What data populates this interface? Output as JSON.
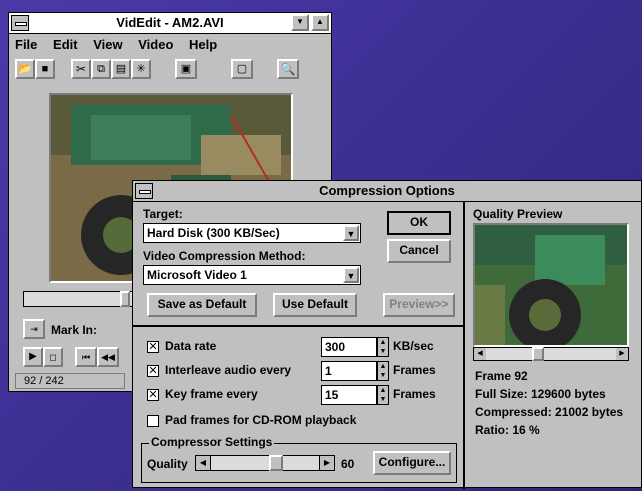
{
  "videdit": {
    "title": "VidEdit - AM2.AVI",
    "menu": [
      "File",
      "Edit",
      "View",
      "Video",
      "Help"
    ],
    "mark_in_label": "Mark In:",
    "frame_status": "92 / 242"
  },
  "dialog": {
    "title": "Compression Options",
    "target_label": "Target:",
    "target_value": "Hard Disk (300 KB/Sec)",
    "method_label": "Video Compression Method:",
    "method_value": "Microsoft Video 1",
    "ok_label": "OK",
    "cancel_label": "Cancel",
    "save_default_label": "Save as Default",
    "use_default_label": "Use Default",
    "preview_label": "Preview>>",
    "data_rate_label": "Data rate",
    "data_rate_value": "300",
    "data_rate_unit": "KB/sec",
    "data_rate_checked": true,
    "interleave_label": "Interleave audio every",
    "interleave_value": "1",
    "interleave_unit": "Frames",
    "interleave_checked": true,
    "keyframe_label": "Key frame every",
    "keyframe_value": "15",
    "keyframe_unit": "Frames",
    "keyframe_checked": true,
    "pad_label": "Pad frames for CD-ROM playback",
    "pad_checked": false,
    "compressor_group_label": "Compressor Settings",
    "quality_label": "Quality",
    "quality_value": "60",
    "quality_fraction": 0.6,
    "configure_label": "Configure..."
  },
  "preview": {
    "title": "Quality Preview",
    "frame": "Frame 92",
    "full_size": "Full Size: 129600 bytes",
    "compressed": "Compressed: 21002 bytes",
    "ratio": "Ratio: 16 %"
  },
  "colors": {
    "desktop": "#3b2f92",
    "title_active": "#c0c0c0",
    "face": "#c0c0c0"
  }
}
